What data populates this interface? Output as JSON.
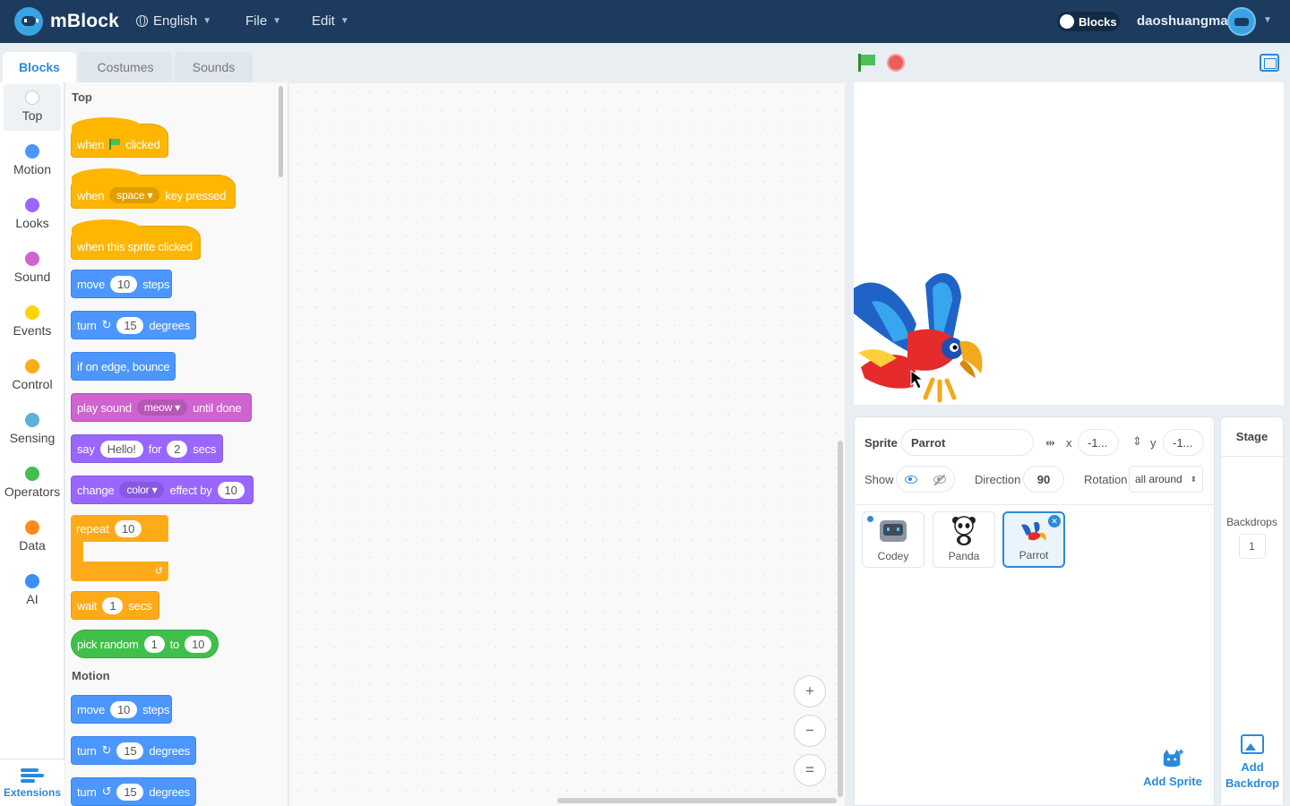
{
  "app": {
    "name": "mBlock"
  },
  "topbar": {
    "language": "English",
    "file": "File",
    "edit": "Edit",
    "mode_toggle": "Blocks",
    "username": "daoshuangma"
  },
  "tabs": [
    {
      "label": "Blocks",
      "active": true
    },
    {
      "label": "Costumes",
      "active": false
    },
    {
      "label": "Sounds",
      "active": false
    }
  ],
  "categories": [
    {
      "label": "Top",
      "color": "#ffffff"
    },
    {
      "label": "Motion",
      "color": "#4c97ff"
    },
    {
      "label": "Looks",
      "color": "#9966ff"
    },
    {
      "label": "Sound",
      "color": "#cf63cf"
    },
    {
      "label": "Events",
      "color": "#ffd500"
    },
    {
      "label": "Control",
      "color": "#ffab19"
    },
    {
      "label": "Sensing",
      "color": "#5cb1d6"
    },
    {
      "label": "Operators",
      "color": "#40bf4a"
    },
    {
      "label": "Data",
      "color": "#ff8c1a"
    },
    {
      "label": "AI",
      "color": "#3b8ff5"
    }
  ],
  "extensions_label": "Extensions",
  "palette": {
    "top_title": "Top",
    "motion_title": "Motion",
    "b_flag": {
      "when": "when",
      "clicked": "clicked"
    },
    "b_key": {
      "when": "when",
      "key": "space",
      "pressed": "key pressed"
    },
    "b_sprite": {
      "text": "when this sprite clicked"
    },
    "b_move": {
      "move": "move",
      "steps_val": "10",
      "steps": "steps"
    },
    "b_turn_r": {
      "turn": "turn",
      "icon": "↻",
      "val": "15",
      "deg": "degrees"
    },
    "b_edge": {
      "text": "if on edge, bounce"
    },
    "b_play": {
      "play": "play sound",
      "sound": "meow",
      "until": "until done"
    },
    "b_say": {
      "say": "say",
      "msg": "Hello!",
      "for": "for",
      "secs_val": "2",
      "secs": "secs"
    },
    "b_effect": {
      "change": "change",
      "effect": "color",
      "by": "effect by",
      "val": "10"
    },
    "b_repeat": {
      "repeat": "repeat",
      "val": "10",
      "loop": "↺"
    },
    "b_wait": {
      "wait": "wait",
      "val": "1",
      "secs": "secs"
    },
    "b_random": {
      "pick": "pick random",
      "from": "1",
      "to": "to",
      "to_val": "10"
    },
    "b_move2": {
      "move": "move",
      "steps_val": "10",
      "steps": "steps"
    },
    "b_turn_r2": {
      "turn": "turn",
      "icon": "↻",
      "val": "15",
      "deg": "degrees"
    },
    "b_turn_l": {
      "turn": "turn",
      "icon": "↺",
      "val": "15",
      "deg": "degrees"
    }
  },
  "zoom": {
    "in": "+",
    "out": "−",
    "reset": "="
  },
  "sprite_info": {
    "sprite_label": "Sprite",
    "sprite_name": "Parrot",
    "x_label": "x",
    "x_value": "-1...",
    "y_label": "y",
    "y_value": "-1...",
    "show_label": "Show",
    "direction_label": "Direction",
    "direction_value": "90",
    "rotation_label": "Rotation",
    "rotation_value": "all around"
  },
  "sprites": [
    {
      "name": "Codey",
      "selected": false
    },
    {
      "name": "Panda",
      "selected": false
    },
    {
      "name": "Parrot",
      "selected": true
    }
  ],
  "add_sprite": "Add Sprite",
  "stage_panel": {
    "title": "Stage",
    "backdrops_label": "Backdrops",
    "backdrops_count": "1",
    "add_backdrop": "Add Backdrop"
  }
}
